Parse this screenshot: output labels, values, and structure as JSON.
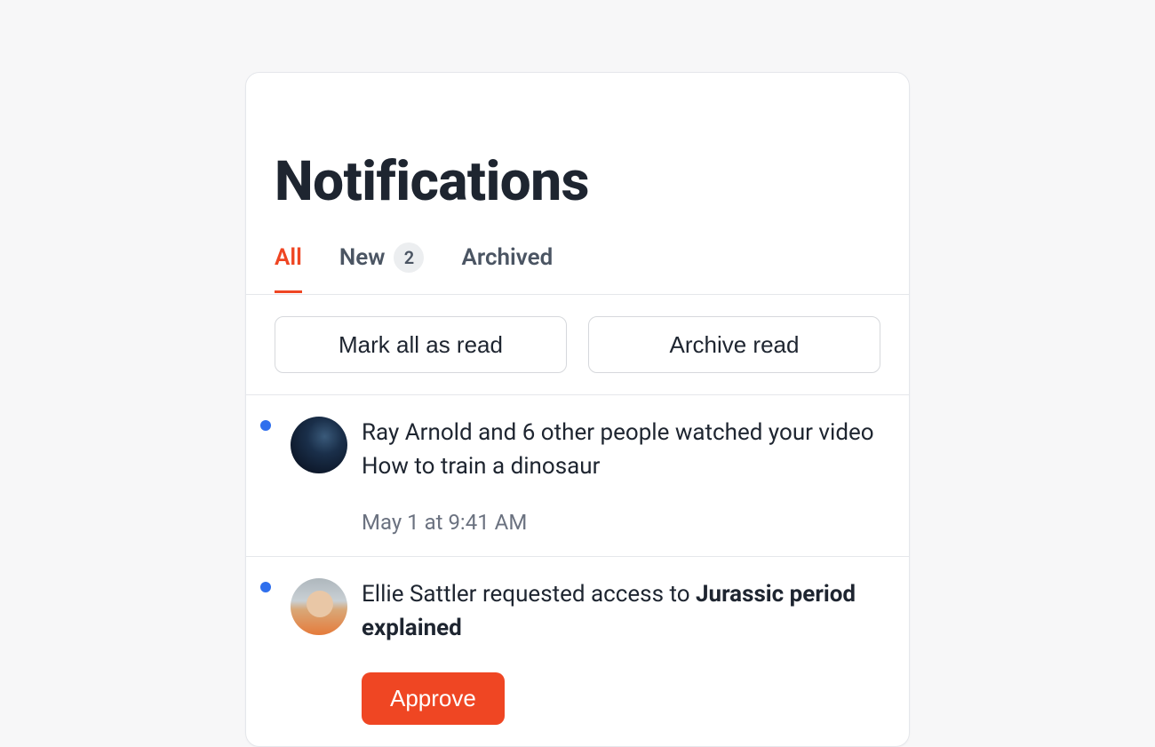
{
  "title": "Notifications",
  "tabs": {
    "all": "All",
    "new": "New",
    "new_count": "2",
    "archived": "Archived"
  },
  "actions": {
    "mark_all": "Mark all as read",
    "archive_read": "Archive read"
  },
  "items": [
    {
      "unread": true,
      "message": "Ray Arnold and 6 other people watched your video How to train a dinosaur",
      "time": "May 1 at 9:41 AM"
    },
    {
      "unread": true,
      "message_prefix": "Ellie Sattler requested access to ",
      "message_bold": "Jurassic period explained",
      "approve_label": "Approve"
    }
  ]
}
